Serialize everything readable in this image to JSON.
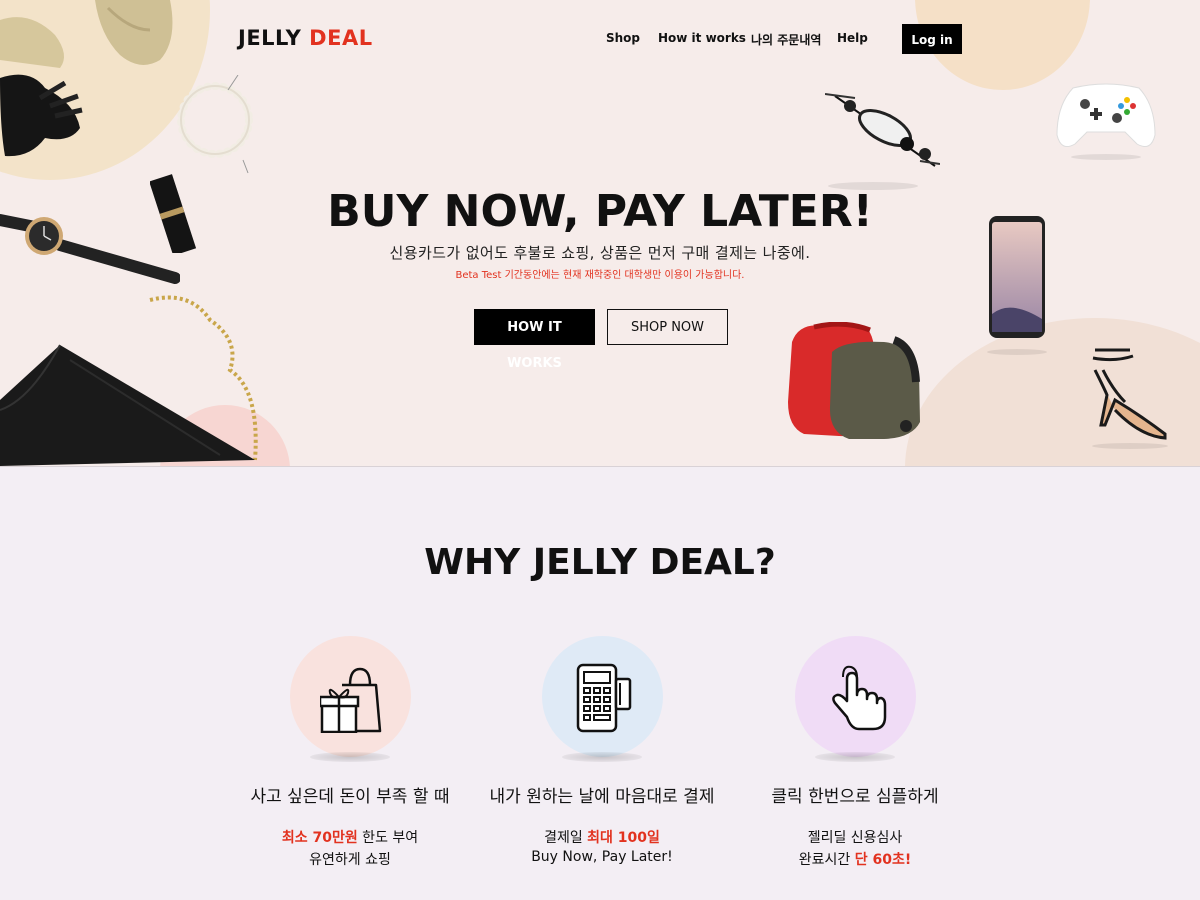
{
  "header": {
    "logo_main": "JELLY",
    "logo_accent": "DEAL",
    "nav": [
      "Shop",
      "How it works",
      "나의 주문내역",
      "Help"
    ],
    "login_label": "Log in"
  },
  "hero": {
    "title": "BUY NOW, PAY LATER!",
    "subtitle": "신용카드가 없어도 후불로 쇼핑, 상품은 먼저 구매 결제는 나중에.",
    "note": "Beta Test 기간동안에는 현재 재학중인 대학생만 이용이 가능합니다.",
    "primary_button": "HOW IT WORKS",
    "secondary_button": "SHOP NOW"
  },
  "why": {
    "title": "WHY JELLY DEAL?",
    "features": [
      {
        "icon": "gift-shopping-bag-icon",
        "color": "#f9e2de",
        "title": "사고 싶은데 돈이 부족 할 때",
        "line1_highlight": "최소 70만원",
        "line1_rest": " 한도 부여",
        "line2": "유연하게 쇼핑"
      },
      {
        "icon": "card-terminal-icon",
        "color": "#dfeaf6",
        "title": "내가 원하는 날에 마음대로 결제",
        "line1_prefix": "결제일 ",
        "line1_highlight": "최대 100일",
        "line2": "Buy Now, Pay Later!"
      },
      {
        "icon": "tap-hand-icon",
        "color": "#f0dcf6",
        "title": "클릭 한번으로 심플하게",
        "line1": "젤리딜 신용심사",
        "line2_prefix": "완료시간 ",
        "line2_highlight": "단 60초!"
      }
    ]
  },
  "colors": {
    "accent": "#e2321f",
    "dark": "#000000"
  }
}
